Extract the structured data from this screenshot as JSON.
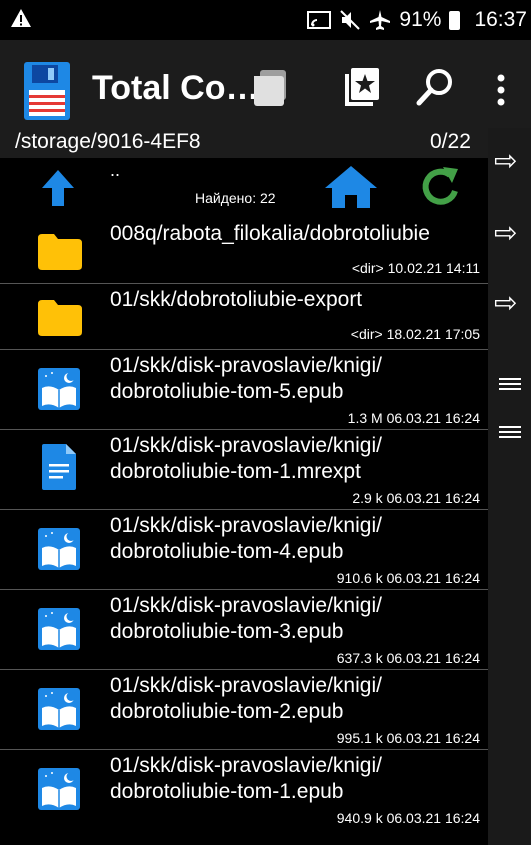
{
  "status": {
    "warning_icon": "warning-icon",
    "battery": "91%",
    "time": "16:37"
  },
  "app_bar": {
    "title": "Total Co…",
    "icons": [
      "floppy-disk-icon",
      "folders-icon",
      "star-tab-icon",
      "search-icon",
      "more-vert-icon"
    ]
  },
  "path_bar": {
    "path": "/storage/9016-4EF8",
    "count": "0/22"
  },
  "nav_row": {
    "up": "..",
    "found": "Найдено: 22"
  },
  "files": [
    {
      "name1": "008q/rabota_filokalia/dobrotoliubie",
      "name2": "",
      "meta": "<dir>  10.02.21  14:11",
      "icon": "folder"
    },
    {
      "name1": "01/skk/dobrotoliubie-export",
      "name2": "",
      "meta": "<dir>  18.02.21  17:05",
      "icon": "folder"
    },
    {
      "name1": "01/skk/disk-pravoslavie/knigi/",
      "name2": "dobrotoliubie-tom-5.epub",
      "meta": "1.3 M  06.03.21  16:24",
      "icon": "book"
    },
    {
      "name1": "01/skk/disk-pravoslavie/knigi/",
      "name2": "dobrotoliubie-tom-1.mrexpt",
      "meta": "2.9 k  06.03.21  16:24",
      "icon": "doc"
    },
    {
      "name1": "01/skk/disk-pravoslavie/knigi/",
      "name2": "dobrotoliubie-tom-4.epub",
      "meta": "910.6 k  06.03.21  16:24",
      "icon": "book"
    },
    {
      "name1": "01/skk/disk-pravoslavie/knigi/",
      "name2": "dobrotoliubie-tom-3.epub",
      "meta": "637.3 k  06.03.21  16:24",
      "icon": "book"
    },
    {
      "name1": "01/skk/disk-pravoslavie/knigi/",
      "name2": "dobrotoliubie-tom-2.epub",
      "meta": "995.1 k  06.03.21  16:24",
      "icon": "book"
    },
    {
      "name1": "01/skk/disk-pravoslavie/knigi/",
      "name2": "dobrotoliubie-tom-1.epub",
      "meta": "940.9 k  06.03.21  16:24",
      "icon": "book"
    }
  ],
  "side": {
    "arrow": "⇨"
  },
  "colors": {
    "folder": "#FFC107",
    "blue": "#1E88E5",
    "green": "#43A047",
    "divider": "#555555"
  }
}
